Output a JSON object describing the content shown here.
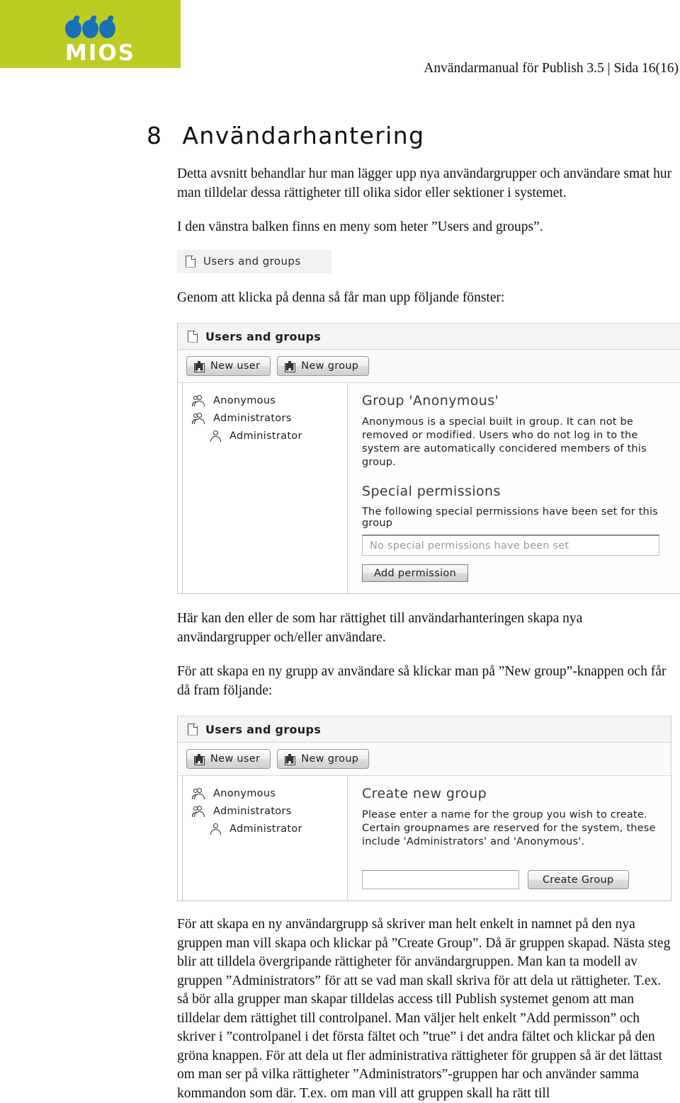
{
  "header": {
    "logo_text": "MIOS",
    "meta": "Användarmanual för Publish 3.5 | Sida 16(16)"
  },
  "section": {
    "number": "8",
    "title": "Användarhantering"
  },
  "paragraphs": {
    "intro": "Detta avsnitt behandlar hur man lägger upp nya användargrupper och användare smat hur man tilldelar dessa rättigheter till olika sidor eller sektioner i systemet.",
    "menu_hint": "I den vänstra balken finns en meny som heter ”Users and groups”.",
    "after_chip": "Genom att klicka på denna så får man upp följande fönster:",
    "after_shot1": "Här kan den eller de som har rättighet till användarhanteringen skapa nya användargrupper och/eller användare.",
    "before_shot2": "För att skapa en ny grupp av användare så klickar man på ”New group”-knappen och får då fram följande:",
    "closing": "För att skapa en ny användargrupp så skriver man helt enkelt in namnet på den nya gruppen man vill skapa och klickar på ”Create Group”. Då är gruppen skapad. Nästa steg blir att tilldela övergripande rättigheter för användargruppen. Man kan ta modell av gruppen ”Administrators” för att se vad man skall skriva för att dela ut rättigheter. T.ex. så bör alla grupper man skapar tilldelas access till Publish systemet genom att man tilldelar dem rättighet till controlpanel. Man väljer helt enkelt ”Add permisson” och skriver i ”controlpanel i det första fältet och ”true” i det andra fältet och klickar på den gröna knappen. För att dela ut fler administrativa rättigheter för gruppen så är det lättast om man ser på vilka rättigheter ”Administrators”-gruppen har och använder samma kommandon som där. T.ex. om man vill att gruppen skall ha rätt till"
  },
  "chip": {
    "label": "Users and groups",
    "icon": "document-icon"
  },
  "screenshot1": {
    "title": "Users and groups",
    "toolbar": {
      "new_user": "New user",
      "new_group": "New group"
    },
    "tree": [
      {
        "label": "Anonymous",
        "type": "group"
      },
      {
        "label": "Administrators",
        "type": "group"
      },
      {
        "label": "Administrator",
        "type": "user"
      }
    ],
    "detail": {
      "heading": "Group 'Anonymous'",
      "description": "Anonymous is a special built in group. It can not be removed or modified. Users who do not log in to the system are automatically concidered members of this group.",
      "permissions_heading": "Special permissions",
      "permissions_note": "The following special permissions have been set for this group",
      "permissions_empty": "No special permissions have been set",
      "add_permission": "Add permission"
    }
  },
  "screenshot2": {
    "title": "Users and groups",
    "toolbar": {
      "new_user": "New user",
      "new_group": "New group"
    },
    "tree": [
      {
        "label": "Anonymous",
        "type": "group"
      },
      {
        "label": "Administrators",
        "type": "group"
      },
      {
        "label": "Administrator",
        "type": "user"
      }
    ],
    "detail": {
      "heading": "Create new group",
      "description": "Please enter a name for the group you wish to create. Certain groupnames are reserved for the system, these include 'Administrators' and 'Anonymous'.",
      "input_value": "",
      "create_button": "Create Group"
    }
  },
  "colors": {
    "brand_green": "#bccc22",
    "logo_blue": "#1a6fb5"
  }
}
